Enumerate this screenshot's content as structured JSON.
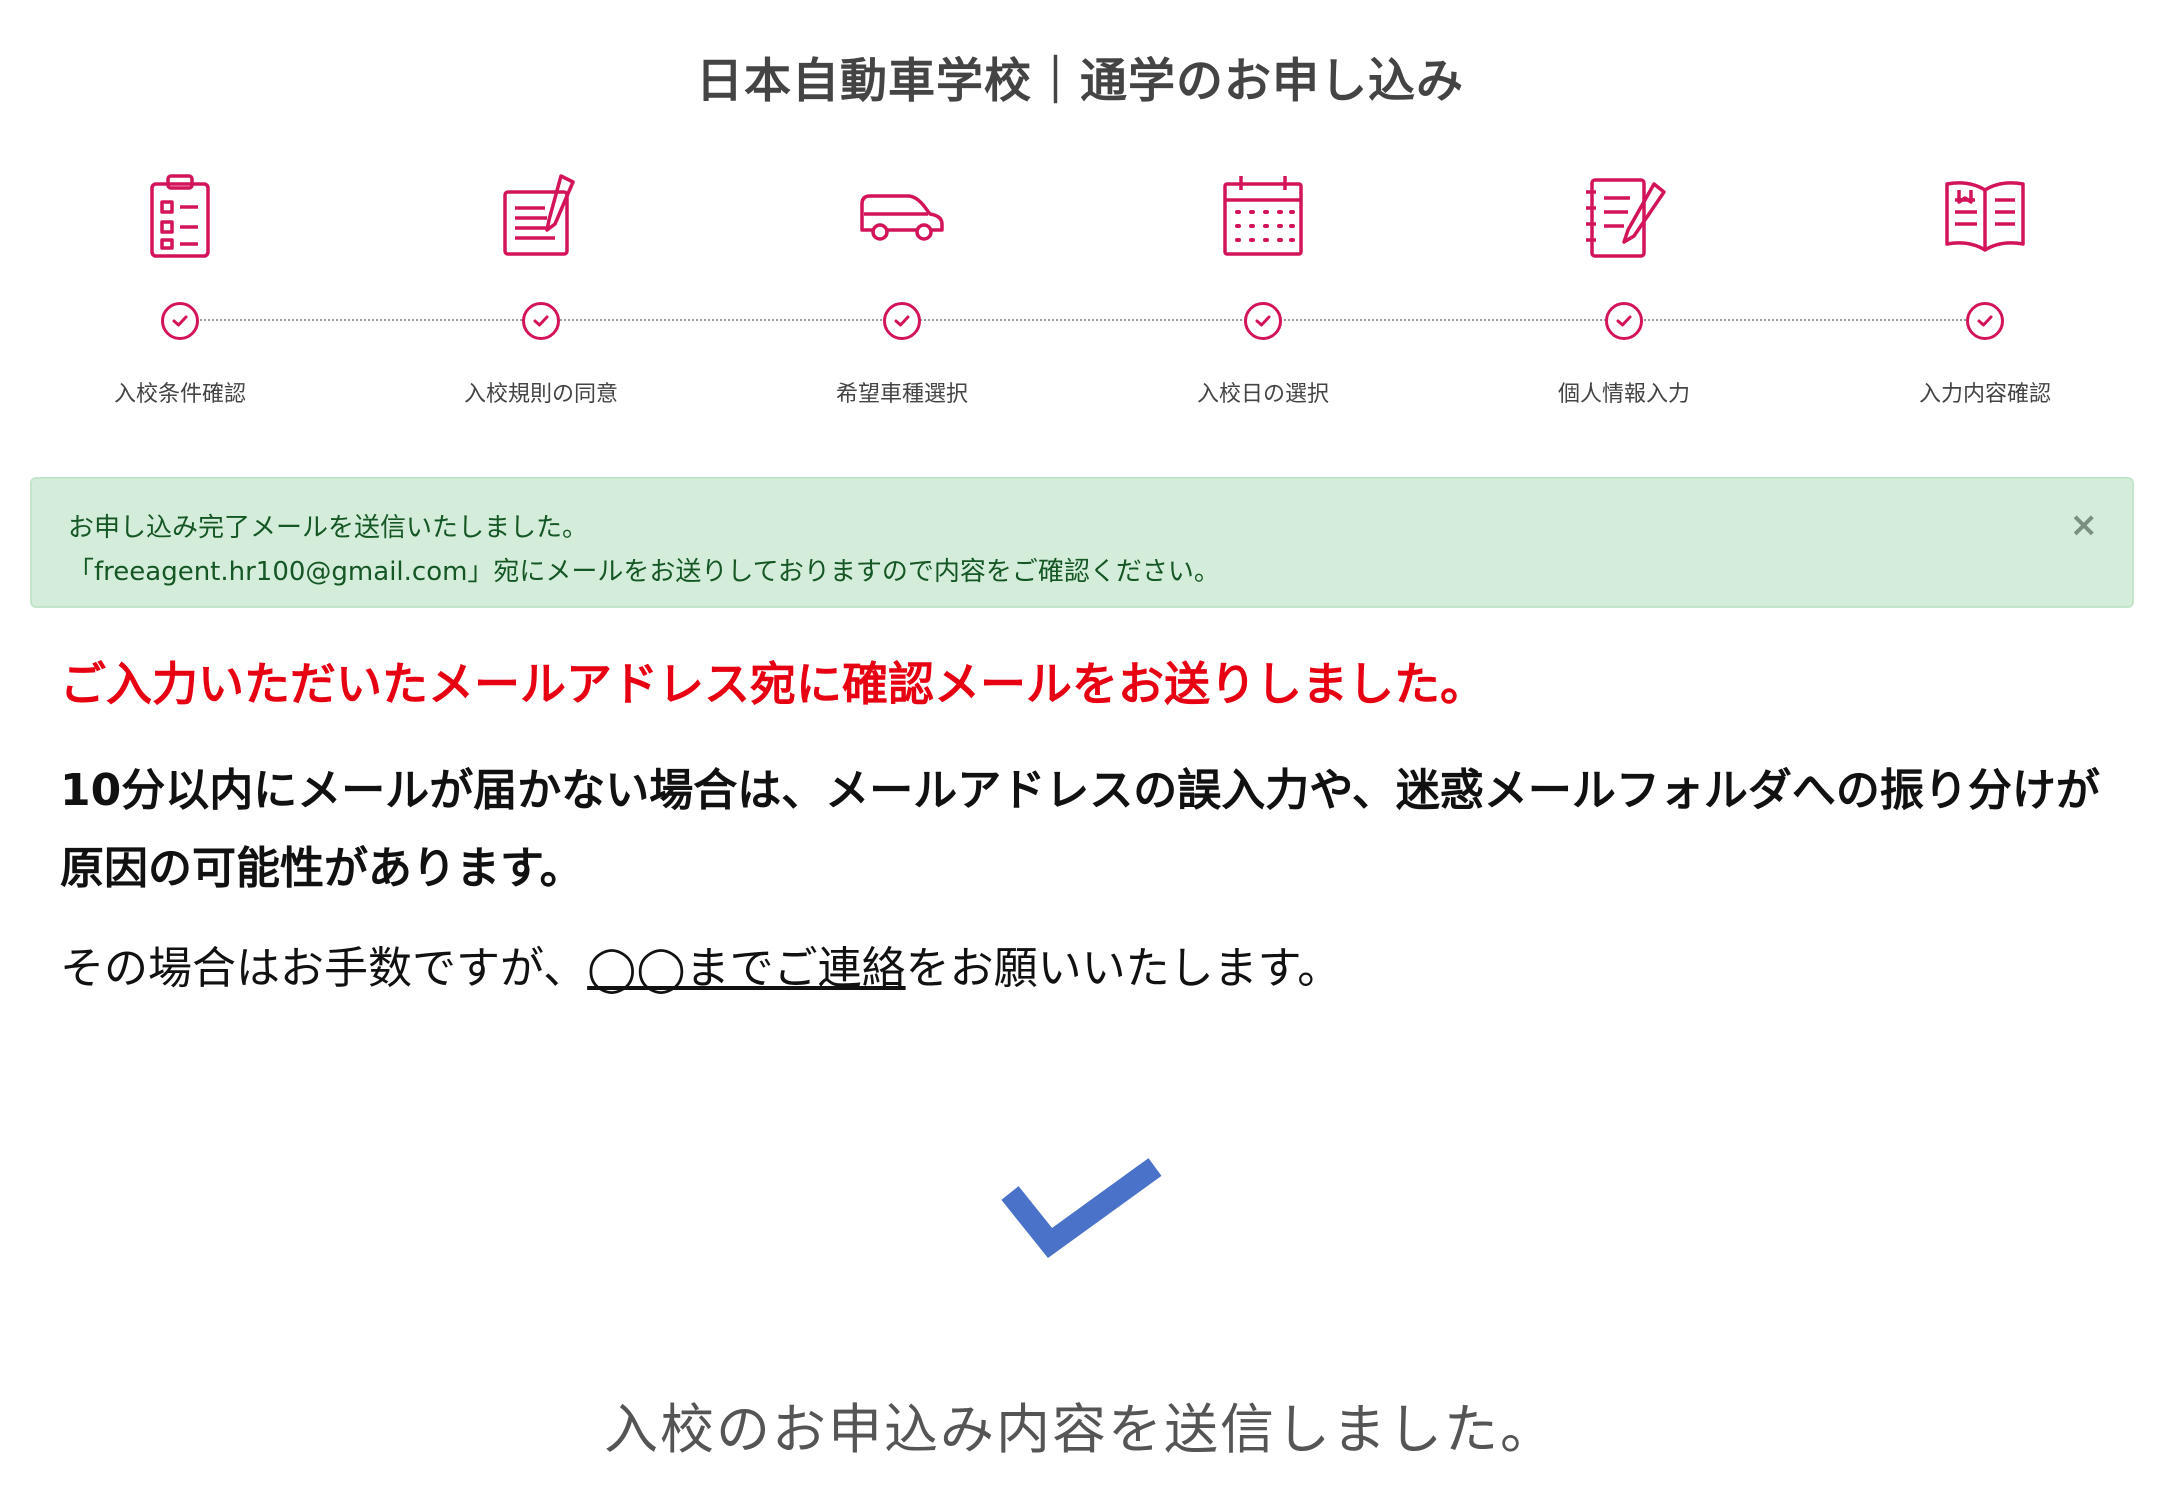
{
  "header": {
    "title": "日本自動車学校｜通学のお申し込み"
  },
  "steps": [
    {
      "label": "入校条件確認",
      "icon": "clipboard-checklist-icon"
    },
    {
      "label": "入校規則の同意",
      "icon": "document-pen-icon"
    },
    {
      "label": "希望車種選択",
      "icon": "car-icon"
    },
    {
      "label": "入校日の選択",
      "icon": "calendar-icon"
    },
    {
      "label": "個人情報入力",
      "icon": "notebook-pen-icon"
    },
    {
      "label": "入力内容確認",
      "icon": "open-book-icon"
    }
  ],
  "colors": {
    "accent": "#d4145a",
    "alert_bg": "#d4edda",
    "alert_text": "#155724",
    "warning_red": "#e60012",
    "check_blue": "#4a72c8"
  },
  "alert": {
    "line1": "お申し込み完了メールを送信いたしました。",
    "line2": "「freeagent.hr100@gmail.com」宛にメールをお送りしておりますので内容をご確認ください。",
    "close": "×"
  },
  "main": {
    "red_heading": "ご入力いただいたメールアドレス宛に確認メールをお送りしました。",
    "bold_para": "10分以内にメールが届かない場合は、メールアドレスの誤入力や、迷惑メールフォルダへの振り分けが原因の可能性があります。",
    "contact_prefix": "その場合はお手数ですが、",
    "contact_link": "◯◯までご連絡",
    "contact_suffix": "をお願いいたします。",
    "done_message": "入校のお申込み内容を送信しました。"
  }
}
